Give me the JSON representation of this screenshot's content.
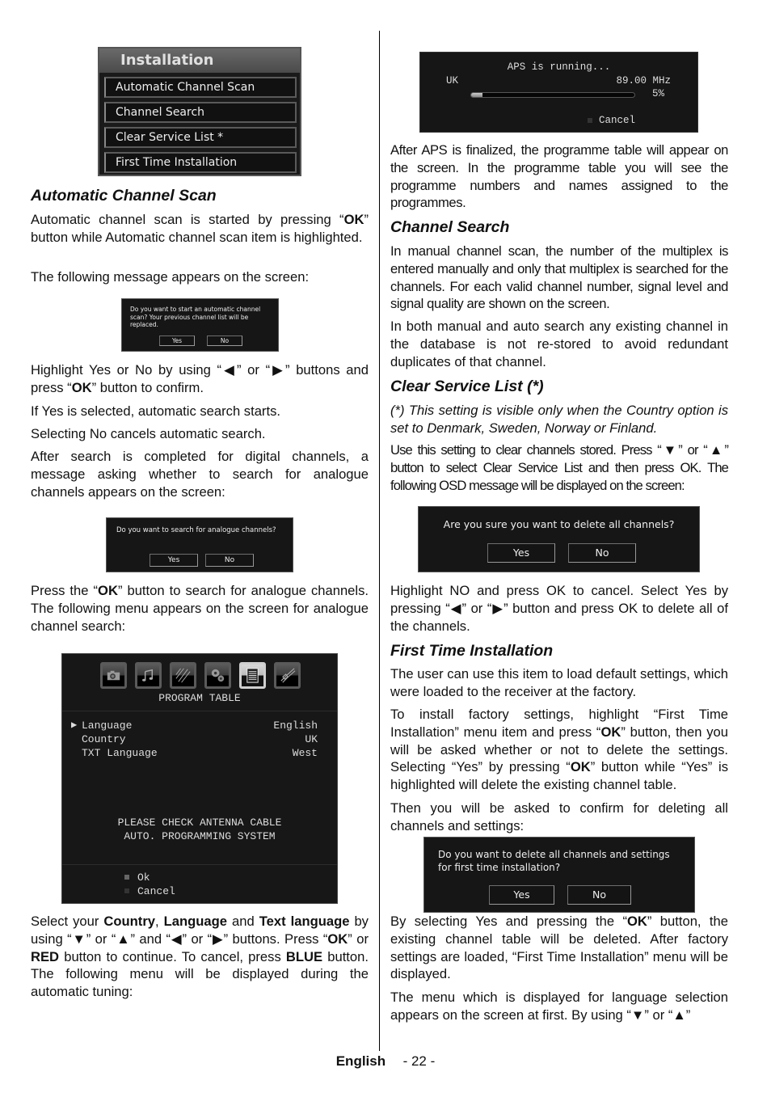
{
  "left_column": {
    "installation_menu": {
      "title": "Installation",
      "items": [
        "Automatic Channel Scan",
        "Channel Search",
        "Clear Service List *",
        "First Time Installation"
      ]
    },
    "section_automatic_channel_scan": {
      "heading": "Automatic Channel Scan",
      "p1_a": "Automatic channel scan is started by pressing “",
      "p1_ok": "OK",
      "p1_b": "” button while Automatic channel scan item is highlighted.",
      "p2": "The following message appears on the screen:"
    },
    "dialog_start_scan": {
      "message": "Do you want to start an automatic channel scan? Your previous channel list will be replaced.",
      "yes": "Yes",
      "no": "No"
    },
    "p_highlight_a": "Highlight Yes or No by using “◀” or “▶” buttons and press “",
    "p_highlight_ok": "OK",
    "p_highlight_b": "” button to confirm.",
    "p_if_yes": "If Yes is selected, automatic search starts.",
    "p_selecting_no": "Selecting No cancels automatic search.",
    "p_after_search": "After search is completed for digital channels, a message asking whether to search for analogue channels appears on the screen:",
    "dialog_analogue": {
      "message": "Do you want to search for analogue channels?",
      "yes": "Yes",
      "no": "No"
    },
    "p_press_ok_a": "Press the “",
    "p_press_ok_ok": "OK",
    "p_press_ok_b": "” button to search for analogue channels. The following menu appears on the screen for analogue channel search:",
    "program_table": {
      "icons": [
        "camera-icon",
        "music-notes-icon",
        "sparkle-lines-icon",
        "gears-icon",
        "document-list-icon",
        "cable-connector-icon"
      ],
      "title": "PROGRAM TABLE",
      "rows": [
        {
          "label": "Language",
          "value": "English",
          "selected": true
        },
        {
          "label": "Country",
          "value": "UK",
          "selected": false
        },
        {
          "label": "TXT Language",
          "value": "West",
          "selected": false
        }
      ],
      "message_line1": "PLEASE CHECK ANTENNA CABLE",
      "message_line2": "AUTO. PROGRAMMING SYSTEM",
      "ok_label": "Ok",
      "cancel_label": "Cancel"
    },
    "p_select": {
      "t1": "Select your ",
      "country": "Country",
      "t2": ", ",
      "language": "Language",
      "t3": " and ",
      "text_language": "Text language",
      "t4": " by using “▼” or “▲”  and  “◀” or “▶” buttons. Press “",
      "ok": "OK",
      "t5": "” or ",
      "red": "RED",
      "t6": " button to continue. To cancel, press ",
      "blue": "BLUE",
      "t7": " button. The following menu will be displayed during the automatic tuning:"
    }
  },
  "right_column": {
    "aps_dialog": {
      "title": "APS is running...",
      "country": "UK",
      "frequency": "89.00 MHz",
      "progress_percent": 5,
      "progress_label": "5%",
      "cancel": "Cancel"
    },
    "p_after_aps": "After APS is finalized, the programme table will appear on the screen. In the programme table you will see the programme numbers and names assigned to the programmes.",
    "section_channel_search": {
      "heading": "Channel Search",
      "p1": "In manual channel scan, the number of the multiplex is entered manually and only that multiplex is searched for the channels. For each valid channel number, signal level and  signal quality are shown on the screen.",
      "p2": "In both manual and auto search any existing channel in the database is not re-stored to avoid redundant duplicates of that channel."
    },
    "section_clear_service_list": {
      "heading": "Clear Service List (*)",
      "note": "(*) This setting is visible only when the Country option is set to Denmark, Sweden, Norway or Finland.",
      "p1": "Use this setting to clear channels stored. Press “▼” or “▲” button to select Clear Service List and then press OK. The following OSD message will be displayed on the screen:"
    },
    "dialog_delete_all": {
      "message": "Are you sure you want to delete all channels?",
      "yes": "Yes",
      "no": "No"
    },
    "p_highlight_no": "Highlight NO and press OK to cancel. Select Yes by pressing “◀” or “▶” button and press OK to delete all of the channels.",
    "section_first_time_installation": {
      "heading": "First Time Installation",
      "p1": "The user can use this item to load default settings, which were loaded to the receiver at the factory.",
      "p2_a": "To install factory settings, highlight “First Time Installation” menu item and press “",
      "p2_ok1": "OK",
      "p2_b": "” button, then you will be asked whether or not to delete the settings. Selecting “Yes” by pressing “",
      "p2_ok2": "OK",
      "p2_c": "” button while “Yes” is highlighted will delete the existing channel table.",
      "p3": "Then you will be asked to confirm for deleting all channels and settings:"
    },
    "dialog_first_time": {
      "message": "Do you want to delete all channels and settings for first time installation?",
      "yes": "Yes",
      "no": "No"
    },
    "p_by_selecting_a": "By selecting Yes and pressing the “",
    "p_by_selecting_ok": "OK",
    "p_by_selecting_b": "” button, the existing channel table will be deleted. After factory settings are loaded, “First Time Installation” menu will be displayed.",
    "p_menu_language": "The menu which is displayed for language selection appears on the screen at first. By using  “▼” or “▲”"
  },
  "footer": {
    "language": "English",
    "page_number": "- 22 -"
  }
}
